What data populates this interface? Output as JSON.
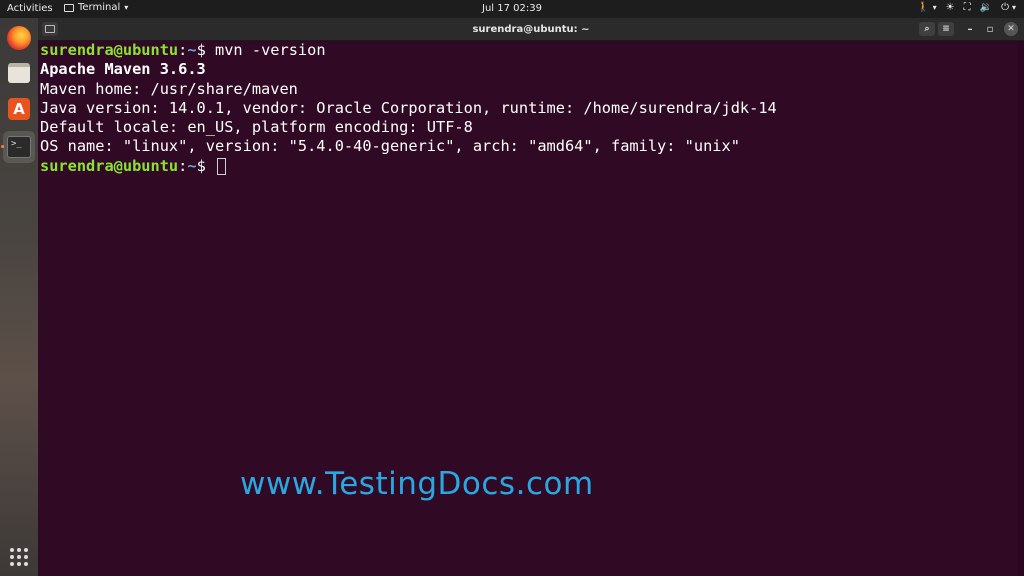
{
  "topbar": {
    "activities": "Activities",
    "app_name": "Terminal",
    "caret": "▾",
    "clock": "Jul 17  02:39",
    "tray": {
      "accessibility_icon": "🚶",
      "brightness_icon": "☀",
      "network_icon": "⛶",
      "volume_icon": "🔉",
      "power_icon": "⏻",
      "caret": "▾"
    }
  },
  "dock": {
    "items": [
      "firefox-icon",
      "files-icon",
      "software-icon",
      "terminal-icon"
    ],
    "software_glyph": "A",
    "terminal_glyph": ">_"
  },
  "window": {
    "title": "surendra@ubuntu: ~",
    "search_glyph": "⌕",
    "menu_glyph": "≡",
    "minimize_glyph": "–",
    "maximize_glyph": "▫",
    "close_glyph": "✕"
  },
  "terminal": {
    "prompt_user": "surendra@ubuntu",
    "prompt_sep": ":",
    "prompt_path": "~",
    "prompt_symbol": "$ ",
    "command": "mvn -version",
    "output": [
      "Apache Maven 3.6.3",
      "Maven home: /usr/share/maven",
      "Java version: 14.0.1, vendor: Oracle Corporation, runtime: /home/surendra/jdk-14",
      "Default locale: en_US, platform encoding: UTF-8",
      "OS name: \"linux\", version: \"5.4.0-40-generic\", arch: \"amd64\", family: \"unix\""
    ]
  },
  "watermark": "www.TestingDocs.com",
  "colors": {
    "terminal_bg": "#300a24",
    "prompt_user": "#8ae234",
    "prompt_path": "#729fcf",
    "watermark": "#2aa7e0"
  }
}
